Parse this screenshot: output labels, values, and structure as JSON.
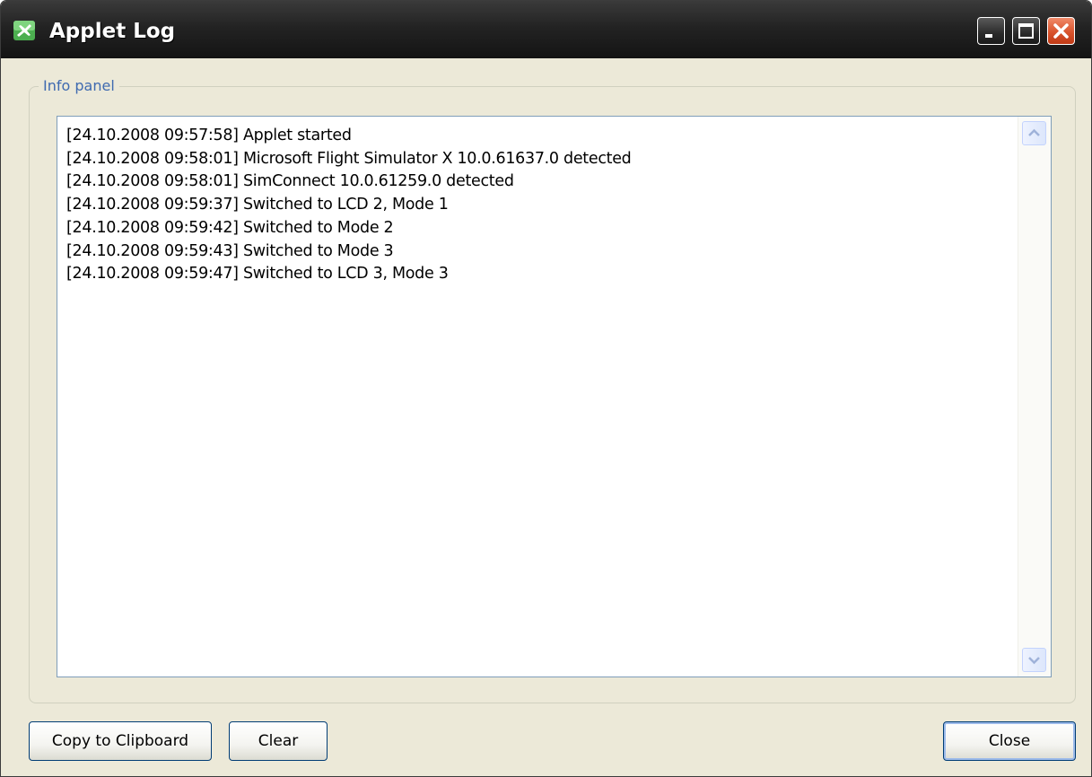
{
  "window": {
    "title": "Applet Log"
  },
  "group": {
    "legend": "Info panel"
  },
  "log": {
    "lines": [
      "[24.10.2008 09:57:58] Applet started",
      "[24.10.2008 09:58:01] Microsoft Flight Simulator X 10.0.61637.0 detected",
      "[24.10.2008 09:58:01] SimConnect 10.0.61259.0 detected",
      "[24.10.2008 09:59:37] Switched to LCD 2, Mode 1",
      "[24.10.2008 09:59:42] Switched to Mode 2",
      "[24.10.2008 09:59:43] Switched to Mode 3",
      "[24.10.2008 09:59:47] Switched to LCD 3, Mode 3"
    ]
  },
  "buttons": {
    "copy_label": "Copy to Clipboard",
    "clear_label": "Clear",
    "close_label": "Close"
  },
  "icons": {
    "app": "airplane-icon",
    "minimize": "minimize-icon",
    "maximize": "maximize-icon",
    "close": "close-icon",
    "scroll_up": "chevron-up-icon",
    "scroll_down": "chevron-down-icon"
  },
  "colors": {
    "title_bar": "#1e1e1e",
    "legend_text": "#3f6ab0",
    "close_button": "#d9532c",
    "button_border": "#003c74"
  }
}
